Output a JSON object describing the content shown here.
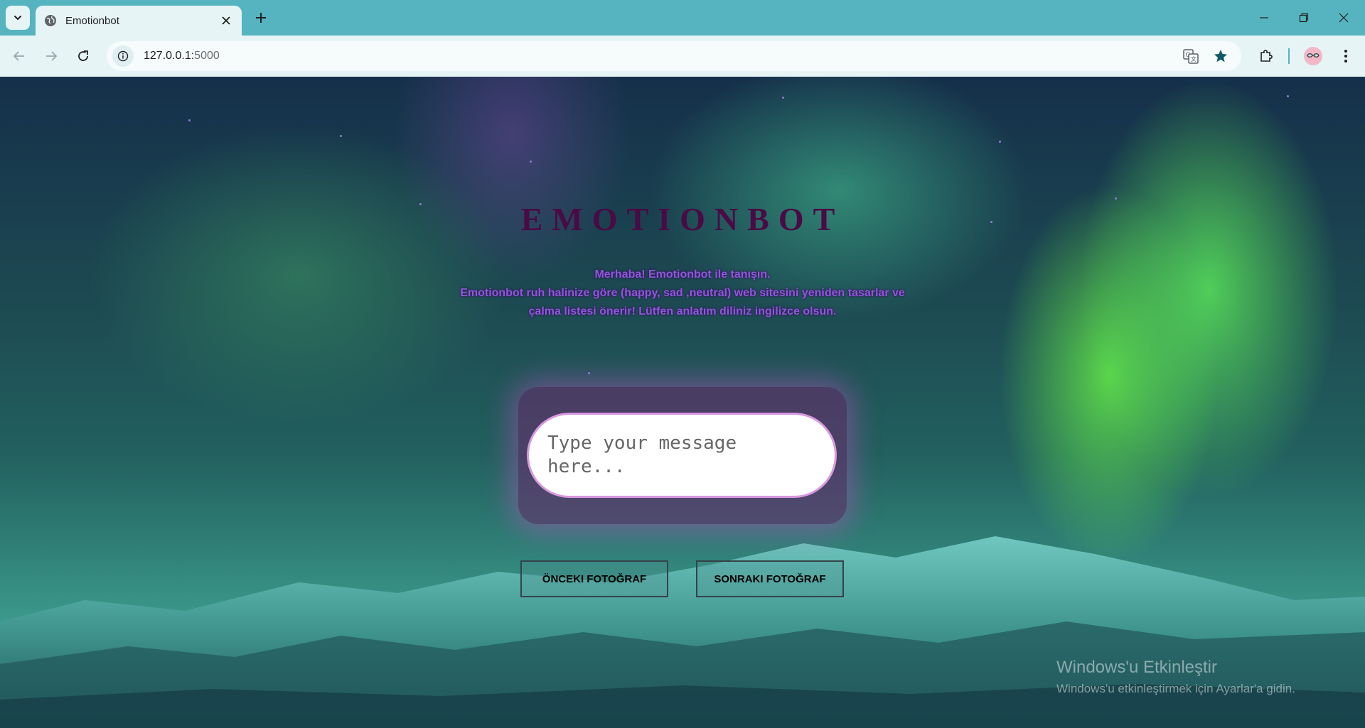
{
  "browser": {
    "tab": {
      "title": "Emotionbot"
    },
    "url": {
      "host": "127.0.0.1:",
      "port": "5000"
    }
  },
  "page": {
    "title": "EMOTIONBOT",
    "intro": [
      "Merhaba! Emotionbot ile tanışın.",
      "Emotionbot ruh halinize göre (happy, sad ,neutral) web sitesini yeniden tasarlar ve",
      "çalma listesi önerir! Lütfen anlatım diliniz ingilizce olsun."
    ],
    "message_input": {
      "placeholder": "Type your message here...",
      "value": ""
    },
    "buttons": {
      "previous": "ÖNCEKI FOTOĞRAF",
      "next": "SONRAKI FOTOĞRAF"
    }
  },
  "watermark": {
    "title": "Windows'u Etkinleştir",
    "subtitle": "Windows'u etkinleştirmek için Ayarlar'a gidin."
  },
  "colors": {
    "chrome_tab_strip": "#55b4c0",
    "chrome_toolbar": "#e6f4f6",
    "title_color": "#4a0a45",
    "intro_text": "#8a5ad6",
    "chat_glow": "#c850c8"
  }
}
